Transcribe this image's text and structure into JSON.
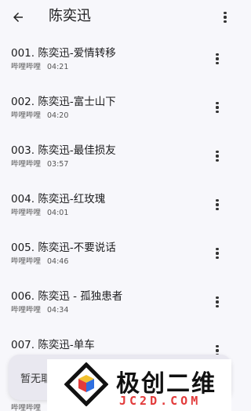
{
  "header": {
    "title": "陈奕迅",
    "back_icon": "arrow-left-icon",
    "menu_icon": "more-vert-icon"
  },
  "songs": [
    {
      "title": "001. 陈奕迅-爱情转移",
      "source": "哔哩哔哩",
      "duration": "04:21"
    },
    {
      "title": "002. 陈奕迅-富士山下",
      "source": "哔哩哔哩",
      "duration": "04:20"
    },
    {
      "title": "003. 陈奕迅-最佳损友",
      "source": "哔哩哔哩",
      "duration": "03:57"
    },
    {
      "title": "004. 陈奕迅-红玫瑰",
      "source": "哔哩哔哩",
      "duration": "04:01"
    },
    {
      "title": "005. 陈奕迅-不要说话",
      "source": "哔哩哔哩",
      "duration": "04:46"
    },
    {
      "title": "006. 陈奕迅 - 孤独患者",
      "source": "哔哩哔哩",
      "duration": "04:34"
    },
    {
      "title": "007. 陈奕迅-单车",
      "source": "",
      "duration": ""
    }
  ],
  "partial_row": {
    "source": "哔哩哔哩"
  },
  "toast": {
    "text": "暂无耶"
  },
  "watermark": {
    "cn": "极创二维",
    "en": "JC2D.COM"
  },
  "colors": {
    "background": "#f7f7fb",
    "toast": "#e9e8f0",
    "watermark_accent": "#e23b3b"
  }
}
